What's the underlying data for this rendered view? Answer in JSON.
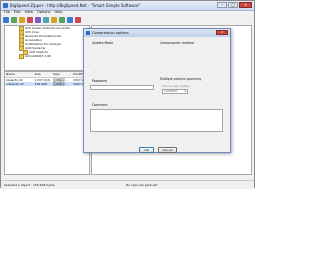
{
  "window": {
    "title": "BigSpeed Zipper - http://BigSpeed.Net - \"Smart Simple Software\"",
    "menu": [
      "File",
      "Edit",
      "View",
      "Options",
      "Help"
    ],
    "toolbar_colors": [
      "#3a7bd5",
      "#5aa35a",
      "#d9a02a",
      "#c94b4b",
      "#7a5ac9",
      "#4aa8b8",
      "#d9a02a",
      "#5aa35a",
      "#3a7bd5",
      "#c94b4b"
    ],
    "close_glyph": "✕",
    "min_glyph": "–",
    "max_glyph": "□"
  },
  "tree": {
    "items": [
      "AVS Amber Outlook Converter",
      "AVS Vrue",
      "Absolute Excel/Recorder",
      "AccelerRun",
      "AcePixelizer Pro Dvlkyst",
      "ACD Systems",
      "ACE Capture",
      "AdminNWAT 2.98"
    ]
  },
  "files": {
    "columns": [
      "Name",
      "Size",
      "Type",
      "Modified"
    ],
    "rows": [
      {
        "name": "bleep32.dll",
        "size": "1 007 016",
        "type": "应用程序...",
        "modified": "2007-01-01"
      },
      {
        "name": "cdeap32.dll",
        "size": "156 608",
        "type": "应用程序...",
        "modified": "2007-01-01"
      }
    ]
  },
  "status": {
    "left": "Selected 1 object : 156 608 bytes",
    "right": "No open zip pack.zpf"
  },
  "dialog": {
    "title": "Compression options",
    "close_glyph": "✕",
    "update_mode_label": "Update Mode",
    "compression_method_label": "Compression method",
    "dashes": [
      "–",
      "–",
      "–",
      "–",
      "–",
      "–"
    ],
    "password_label": "Password",
    "multiple_volume_label": "Multiple volume spanning",
    "volume_placeholder": "Volume size (bytes)",
    "volume_value": "1440000",
    "comment_label": "Comment",
    "ok_label": "OK",
    "cancel_label": "Cancel"
  },
  "right_pane_text": "No open zip pack.zpf"
}
